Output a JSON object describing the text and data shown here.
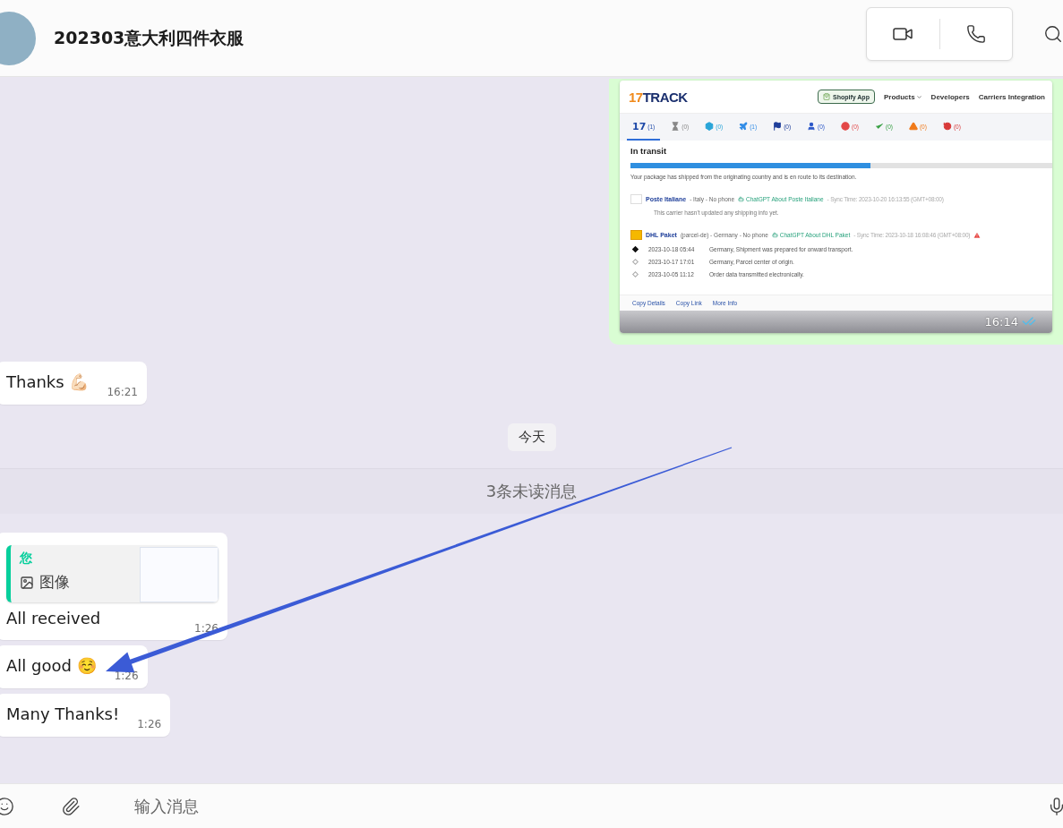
{
  "header": {
    "title": "202303意大利四件衣服"
  },
  "chat": {
    "items": [
      {
        "kind": "image",
        "outgoing": true,
        "time": "16:14",
        "read": true,
        "shot": {
          "logo_number": "17",
          "logo_word": "TRACK",
          "nav": [
            {
              "kind": "app",
              "label": "Shopify App"
            },
            {
              "kind": "menu",
              "label": "Products"
            },
            {
              "kind": "link",
              "label": "Developers"
            },
            {
              "kind": "link",
              "label": "Carriers Integration"
            }
          ],
          "tabs": [
            {
              "kind": "logo",
              "label": "17",
              "count": "(1)",
              "color": "#1f4aa8",
              "selected": true
            },
            {
              "kind": "hourglass",
              "count": "(0)",
              "color": "#888888",
              "selected": false
            },
            {
              "kind": "box",
              "count": "(0)",
              "color": "#2aa5d8",
              "selected": false
            },
            {
              "kind": "plane",
              "count": "(1)",
              "color": "#2f8be6",
              "selected": false
            },
            {
              "kind": "flag",
              "count": "(0)",
              "color": "#1f3f9a",
              "selected": false
            },
            {
              "kind": "person",
              "count": "(0)",
              "color": "#2a56c8",
              "selected": false
            },
            {
              "kind": "sad",
              "count": "(0)",
              "color": "#e34848",
              "selected": false
            },
            {
              "kind": "check",
              "count": "(0)",
              "color": "#3aa046",
              "selected": false
            },
            {
              "kind": "warning",
              "count": "(0)",
              "color": "#f07a1a",
              "selected": false
            },
            {
              "kind": "history",
              "count": "(0)",
              "color": "#d83a3a",
              "selected": false
            }
          ],
          "status": "In transit",
          "progress": {
            "level": 0.57
          },
          "description": "Your package has shipped from the originating country and is en route to its destination.",
          "carriers": [
            {
              "kind": "post",
              "name": "Poste Italiane",
              "meta": "- Italy - No phone",
              "gpt": "ChatGPT About Poste Italiane",
              "sync": "- Sync Time: 2023-10-20 16:13:55 (GMT+08:00)",
              "warning": false,
              "note": "This carrier hasn't updated any shipping info yet."
            },
            {
              "kind": "dhl",
              "name": "DHL Paket",
              "meta": "(parcel-de) - Germany - No phone",
              "gpt": "ChatGPT About DHL Paket",
              "sync": "- Sync Time: 2023-10-18 16:08:46 (GMT+08:00)",
              "warning": true,
              "events": [
                {
                  "time": "2023-10-18 05:44",
                  "text": "Germany, Shipment was prepared for onward transport.",
                  "latest": true
                },
                {
                  "time": "2023-10-17 17:01",
                  "text": "Germany, Parcel center of origin.",
                  "latest": false
                },
                {
                  "time": "2023-10-05 11:12",
                  "text": "Order data transmitted electronically.",
                  "latest": false
                }
              ]
            }
          ],
          "actions": [
            "Copy Details",
            "Copy Link",
            "More Info"
          ]
        }
      },
      {
        "kind": "text",
        "outgoing": false,
        "text": "Thanks 💪🏻",
        "time": "16:21"
      },
      {
        "kind": "date",
        "text": "今天"
      },
      {
        "kind": "unread",
        "text": "3条未读消息"
      },
      {
        "kind": "reply",
        "outgoing": false,
        "quote": {
          "author": "您",
          "label": "图像"
        },
        "text": "All received",
        "time": "1:26"
      },
      {
        "kind": "text",
        "outgoing": false,
        "text": "All good ☺️",
        "time": "1:26"
      },
      {
        "kind": "text",
        "outgoing": false,
        "text": "Many Thanks!",
        "time": "1:26"
      }
    ]
  },
  "composer": {
    "placeholder": "输入消息"
  }
}
